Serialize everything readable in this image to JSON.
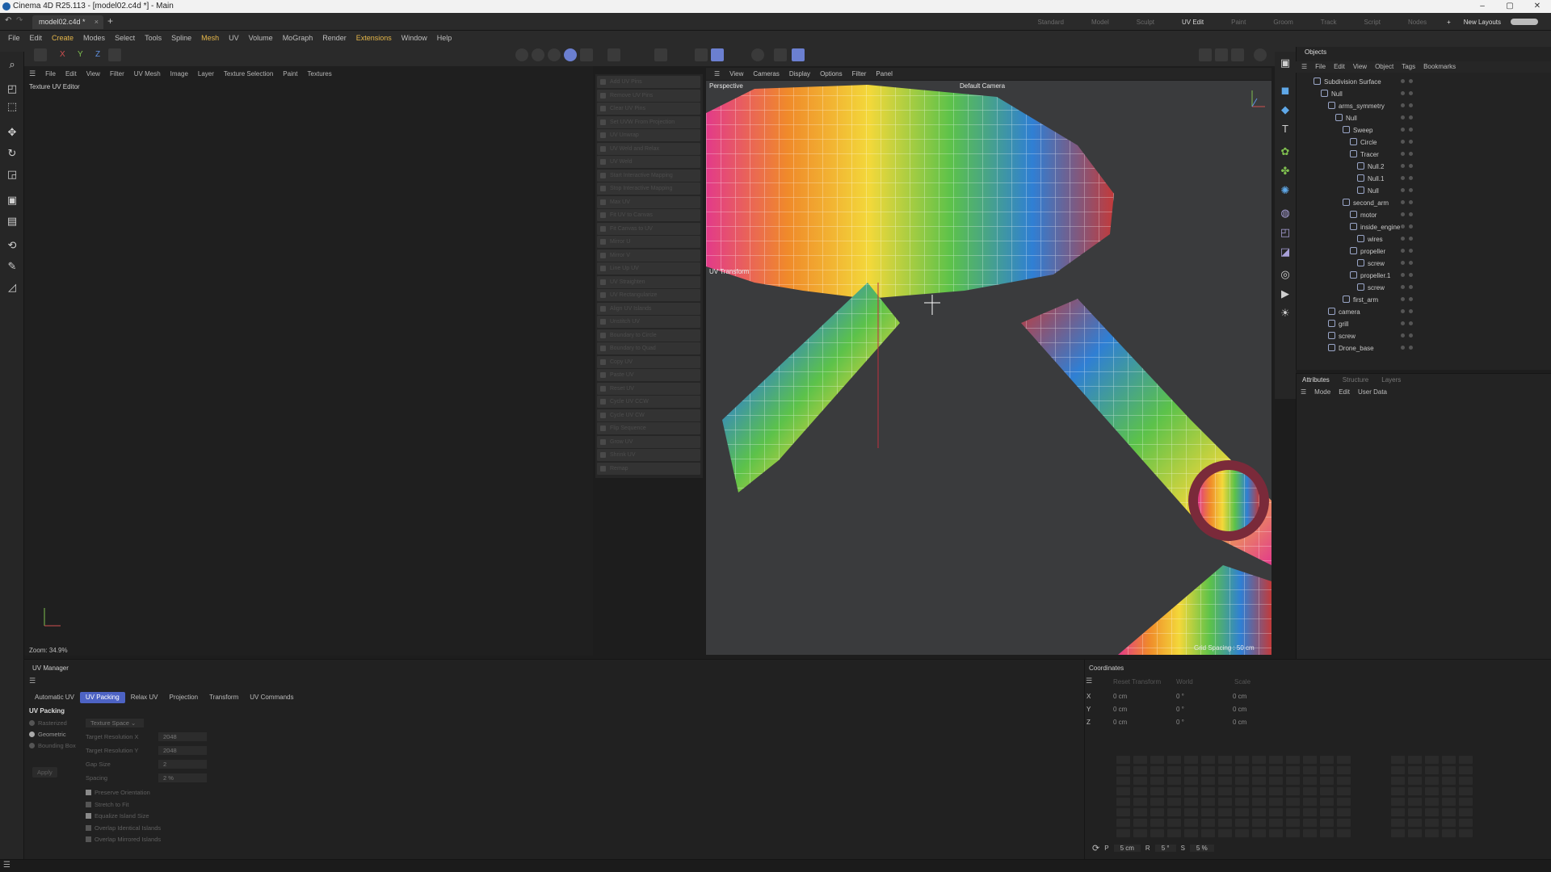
{
  "window": {
    "title": "Cinema 4D R25.113 - [model02.c4d *] - Main",
    "controls": [
      "–",
      "▢",
      "✕"
    ]
  },
  "tabs": {
    "document": "model02.c4d *",
    "close": "×",
    "new": "+"
  },
  "layouts": {
    "items": [
      "Standard",
      "Model",
      "Sculpt",
      "UV Edit",
      "Paint",
      "Groom",
      "Track",
      "Script",
      "Nodes"
    ],
    "active": "UV Edit",
    "add": "+",
    "new_layouts": "New Layouts"
  },
  "menu": [
    "File",
    "Edit",
    "Create",
    "Modes",
    "Select",
    "Tools",
    "Spline",
    "Mesh",
    "UV",
    "Volume",
    "MoGraph",
    "Render",
    "Extensions",
    "Window",
    "Help"
  ],
  "axis_buttons": [
    "X",
    "Y",
    "Z"
  ],
  "uv_editor": {
    "menu": [
      "File",
      "Edit",
      "View",
      "Filter",
      "UV Mesh",
      "Image",
      "Layer",
      "Texture Selection",
      "Paint",
      "Textures"
    ],
    "title": "Texture UV Editor",
    "zoom": "Zoom: 34.9%"
  },
  "uv_commands": [
    "Add UV Pins",
    "Remove UV Pins",
    "Clear UV Pins",
    "Set UVW From Projection",
    "UV Unwrap",
    "UV Weld and Relax",
    "UV Weld",
    "Start Interactive Mapping",
    "Stop Interactive Mapping",
    "Max UV",
    "Fit UV to Canvas",
    "Fit Canvas to UV",
    "Mirror U",
    "Mirror V",
    "Line Up UV",
    "UV Straighten",
    "UV Rectangularize",
    "Align UV Islands",
    "Unstitch UV",
    "Boundary to Circle",
    "Boundary to Quad",
    "Copy UV",
    "Paste UV",
    "Reset UV",
    "Cycle UV CCW",
    "Cycle UV CW",
    "Flip Sequence",
    "Grow UV",
    "Shrink UV",
    "Remap"
  ],
  "viewport": {
    "menu": [
      "View",
      "Cameras",
      "Display",
      "Options",
      "Filter",
      "Panel"
    ],
    "mode": "Perspective",
    "camera": "Default Camera",
    "uv_transform": "UV Transform",
    "grid_spacing": "Grid Spacing : 50 cm"
  },
  "objects": {
    "tabs": [
      "Objects",
      "Takes"
    ],
    "active_tab": "Objects",
    "menu": [
      "File",
      "Edit",
      "View",
      "Object",
      "Tags",
      "Bookmarks"
    ],
    "tree": [
      {
        "name": "Subdivision Surface",
        "indent": 0
      },
      {
        "name": "Null",
        "indent": 1
      },
      {
        "name": "arms_symmetry",
        "indent": 2
      },
      {
        "name": "Null",
        "indent": 3
      },
      {
        "name": "Sweep",
        "indent": 4
      },
      {
        "name": "Circle",
        "indent": 5
      },
      {
        "name": "Tracer",
        "indent": 5
      },
      {
        "name": "Null.2",
        "indent": 6
      },
      {
        "name": "Null.1",
        "indent": 6
      },
      {
        "name": "Null",
        "indent": 6
      },
      {
        "name": "second_arm",
        "indent": 4
      },
      {
        "name": "motor",
        "indent": 5
      },
      {
        "name": "inside_engine",
        "indent": 5
      },
      {
        "name": "wires",
        "indent": 6
      },
      {
        "name": "propeller",
        "indent": 5
      },
      {
        "name": "screw",
        "indent": 6
      },
      {
        "name": "propeller.1",
        "indent": 5
      },
      {
        "name": "screw",
        "indent": 6
      },
      {
        "name": "first_arm",
        "indent": 4
      },
      {
        "name": "camera",
        "indent": 2
      },
      {
        "name": "grill",
        "indent": 2
      },
      {
        "name": "screw",
        "indent": 2
      },
      {
        "name": "Drone_base",
        "indent": 2
      }
    ]
  },
  "attributes": {
    "tabs": [
      "Attributes",
      "Structure",
      "Layers"
    ],
    "menu": [
      "Mode",
      "Edit",
      "User Data"
    ]
  },
  "uv_manager": {
    "title": "UV Manager",
    "tabs": [
      "Automatic UV",
      "UV Packing",
      "Relax UV",
      "Projection",
      "Transform",
      "UV Commands"
    ],
    "active_tab": "UV Packing",
    "section": "UV Packing",
    "modes": [
      "Rasterized",
      "Geometric",
      "Bounding Box"
    ],
    "selected_mode": "Geometric",
    "apply": "Apply",
    "space_label": "Texture Space",
    "fields": [
      {
        "label": "Target Resolution X",
        "value": "2048"
      },
      {
        "label": "Target Resolution Y",
        "value": "2048"
      },
      {
        "label": "Gap Size",
        "value": "2"
      },
      {
        "label": "Spacing",
        "value": "2 %"
      }
    ],
    "options": [
      {
        "label": "Preserve Orientation",
        "checked": true
      },
      {
        "label": "Stretch to Fit",
        "checked": false
      },
      {
        "label": "Equalize Island Size",
        "checked": true
      },
      {
        "label": "Overlap Identical Islands",
        "checked": false
      },
      {
        "label": "Overlap Mirrored Islands",
        "checked": false
      }
    ]
  },
  "coordinates": {
    "title": "Coordinates",
    "dropdowns": [
      "Reset Transform",
      "World",
      "Scale"
    ],
    "rows": [
      {
        "axis": "X",
        "pos": "0 cm",
        "rot": "0 °",
        "size": "0 cm"
      },
      {
        "axis": "Y",
        "pos": "0 cm",
        "rot": "0 °",
        "size": "0 cm"
      },
      {
        "axis": "Z",
        "pos": "0 cm",
        "rot": "0 °",
        "size": "0 cm"
      }
    ],
    "snap": {
      "p_label": "P",
      "p": "5 cm",
      "r_label": "R",
      "r": "5 °",
      "s_label": "S",
      "s": "5 %"
    }
  }
}
